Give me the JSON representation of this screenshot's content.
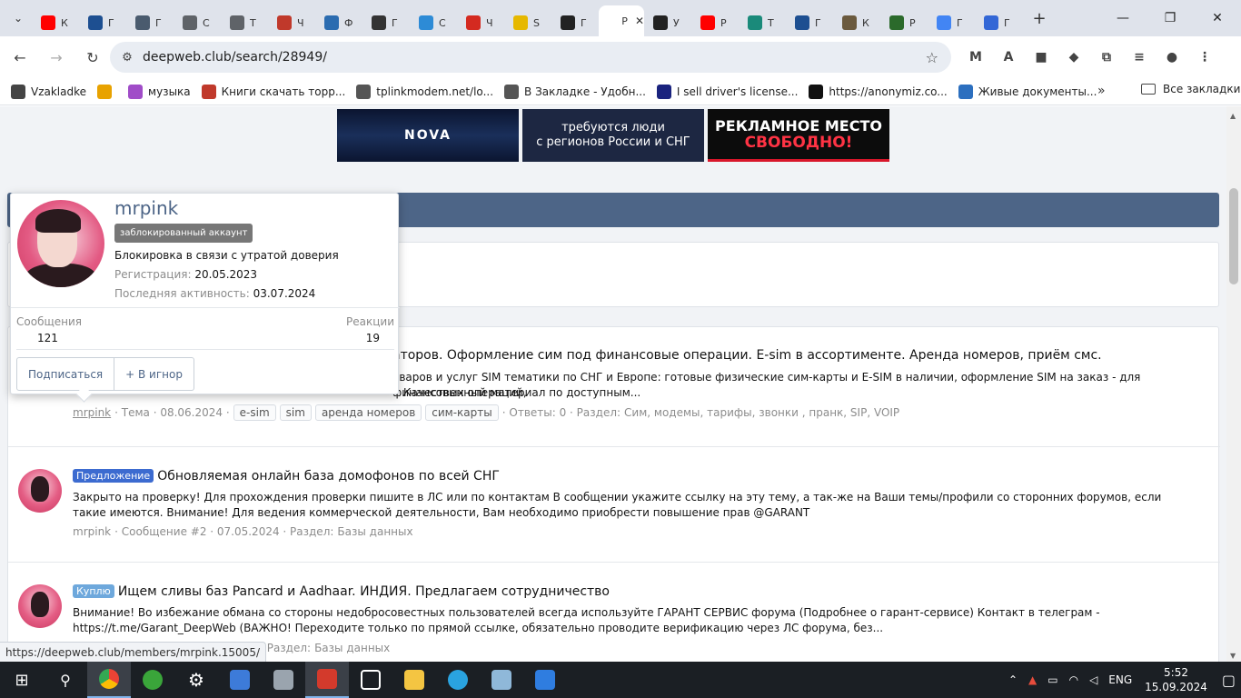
{
  "browser": {
    "tabs": [
      {
        "label": "К",
        "color": "#ff0000"
      },
      {
        "label": "Г",
        "color": "#1d4f91"
      },
      {
        "label": "Г",
        "color": "#4a5b6e"
      },
      {
        "label": "С",
        "color": "#5f6368"
      },
      {
        "label": "Т",
        "color": "#5f6368"
      },
      {
        "label": "Ч",
        "color": "#c0392b"
      },
      {
        "label": "Ф",
        "color": "#2b6cb0"
      },
      {
        "label": "Г",
        "color": "#333333"
      },
      {
        "label": "С",
        "color": "#2d8bd6"
      },
      {
        "label": "Ч",
        "color": "#d42a20"
      },
      {
        "label": "S",
        "color": "#e6b800"
      },
      {
        "label": "Г",
        "color": "#222222"
      },
      {
        "label": "Р",
        "color": "#ffffff",
        "active": true
      },
      {
        "label": "У",
        "color": "#222222"
      },
      {
        "label": "Р",
        "color": "#ff0000"
      },
      {
        "label": "Т",
        "color": "#1a8a7a"
      },
      {
        "label": "Г",
        "color": "#1d4f91"
      },
      {
        "label": "К",
        "color": "#6b5a3e"
      },
      {
        "label": "Р",
        "color": "#2b6a2b"
      },
      {
        "label": "Г",
        "color": "#4285f4"
      },
      {
        "label": "Г",
        "color": "#3367d6"
      }
    ],
    "url": "deepweb.club/search/28949/",
    "extensions": [
      "M",
      "A",
      "■",
      "◆",
      "⧉",
      "≡",
      "●",
      "⋮"
    ],
    "bookmarks": [
      {
        "label": "Vzakladke",
        "color": "#444444"
      },
      {
        "label": "",
        "color": "#e8a200"
      },
      {
        "label": "музыка",
        "color": "#a04cc8"
      },
      {
        "label": "Книги скачать торр...",
        "color": "#c0392b"
      },
      {
        "label": "tplinkmodem.net/lo...",
        "color": "#555555"
      },
      {
        "label": "В Закладке - Удобн...",
        "color": "#555555"
      },
      {
        "label": "I sell driver's license...",
        "color": "#1a237e"
      },
      {
        "label": "https://anonymiz.co...",
        "color": "#111111"
      },
      {
        "label": "Живые документы...",
        "color": "#2c6fbf"
      }
    ],
    "bookmarks_more": "»",
    "all_bookmarks": "Все закладки",
    "status_url": "https://deepweb.club/members/mrpink.15005/"
  },
  "banners": [
    {
      "text": "NOVA"
    },
    {
      "text": "требуются люди\nс регионов России и СНГ"
    },
    {
      "line1": "РЕКЛАМНОЕ МЕСТО",
      "line2": "СВОБОДНО!"
    }
  ],
  "tooltip": {
    "name": "mrpink",
    "badge": "заблокированный аккаунт",
    "status": "Блокировка в связи с утратой доверия",
    "reg_label": "Регистрация:",
    "reg_value": "20.05.2023",
    "last_label": "Последняя активность:",
    "last_value": "03.07.2024",
    "messages_label": "Сообщения",
    "messages_value": "121",
    "reactions_label": "Реакции",
    "reactions_value": "19",
    "follow_label": "Подписаться",
    "ignore_label": "+ В игнор"
  },
  "results": [
    {
      "title": "аторов. Оформление сим под финансовые операции. E-sim в ассортименте. Аренда номеров, приём смс.",
      "snippet": "оваров и услуг SIM тематики по СНГ и Европе: готовые физические сим-карты и E-SIM в наличии, оформление SIM на заказ - для финансовых операций,",
      "snippet2": "Качественный материал по доступным...",
      "author": "mrpink",
      "meta1": "· Тема · 08.06.2024 ·",
      "tags": [
        "e-sim",
        "sim",
        "аренда номеров",
        "сим-карты"
      ],
      "meta2": "· Ответы: 0 · Раздел:",
      "section": "Сим, модемы, тарифы, звонки , пранк, SIP, VOIP"
    },
    {
      "prefix": "Предложение",
      "title": "Обновляемая онлайн база домофонов по всей СНГ",
      "snippet": "Закрыто на проверку! Для прохождения проверки пишите в ЛС или по контактам В сообщении укажите ссылку на эту тему, а так-же на Ваши темы/профили со сторонних форумов, если такие имеются. Внимание! Для ведения коммерческой деятельности, Вам необходимо приобрести повышение прав @GARANT",
      "author": "mrpink",
      "meta1": "· Сообщение #2 · 07.05.2024 · Раздел:",
      "section": "Базы данных"
    },
    {
      "prefix": "Куплю",
      "title": "Ищем сливы баз Pancard и Aadhaar. ИНДИЯ. Предлагаем сотрудничество",
      "snippet": "Внимание! Во избежание обмана со стороны недобросовестных пользователей всегда используйте ГАРАНТ СЕРВИС форума (Подробнее о гарант-сервисе) Контакт в телеграм - https://t.me/Garant_DeepWeb (ВАЖНО! Переходите только по прямой ссылке, обязательно проводите верификацию через ЛС форума, без...",
      "meta_tail": "24 · Раздел:",
      "section": "Базы данных"
    }
  ],
  "taskbar": {
    "lang": "ENG",
    "time": "5:52",
    "date": "15.09.2024"
  }
}
